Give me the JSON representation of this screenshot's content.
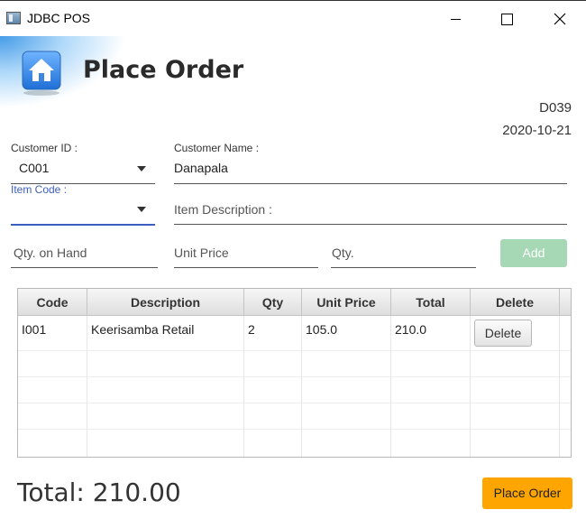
{
  "window": {
    "title": "JDBC POS",
    "controls": [
      "minimize",
      "maximize",
      "close"
    ]
  },
  "header": {
    "title": "Place Order",
    "icon": "home-icon",
    "order_id": "D039",
    "order_date": "2020-10-21"
  },
  "form": {
    "customer_id": {
      "label": "Customer ID :",
      "value": "C001"
    },
    "customer_name": {
      "label": "Customer Name :",
      "value": "Danapala"
    },
    "item_code": {
      "label": "Item Code :",
      "value": ""
    },
    "item_description": {
      "placeholder": "Item Description :",
      "value": ""
    },
    "qty_on_hand": {
      "placeholder": "Qty. on Hand"
    },
    "unit_price": {
      "placeholder": "Unit Price"
    },
    "qty": {
      "placeholder": "Qty."
    },
    "add_label": "Add"
  },
  "table": {
    "columns": [
      "Code",
      "Description",
      "Qty",
      "Unit Price",
      "Total",
      "Delete"
    ],
    "rows": [
      {
        "code": "I001",
        "description": "Keerisamba Retail",
        "qty": "2",
        "unit_price": "105.0",
        "total": "210.0",
        "delete_label": "Delete"
      }
    ]
  },
  "footer": {
    "total_text": "Total: 210.00",
    "place_order_label": "Place Order"
  },
  "colors": {
    "accent_focus": "#3b5fc0",
    "add_button": "#a6d8b5",
    "place_order_button": "#ffa500"
  }
}
